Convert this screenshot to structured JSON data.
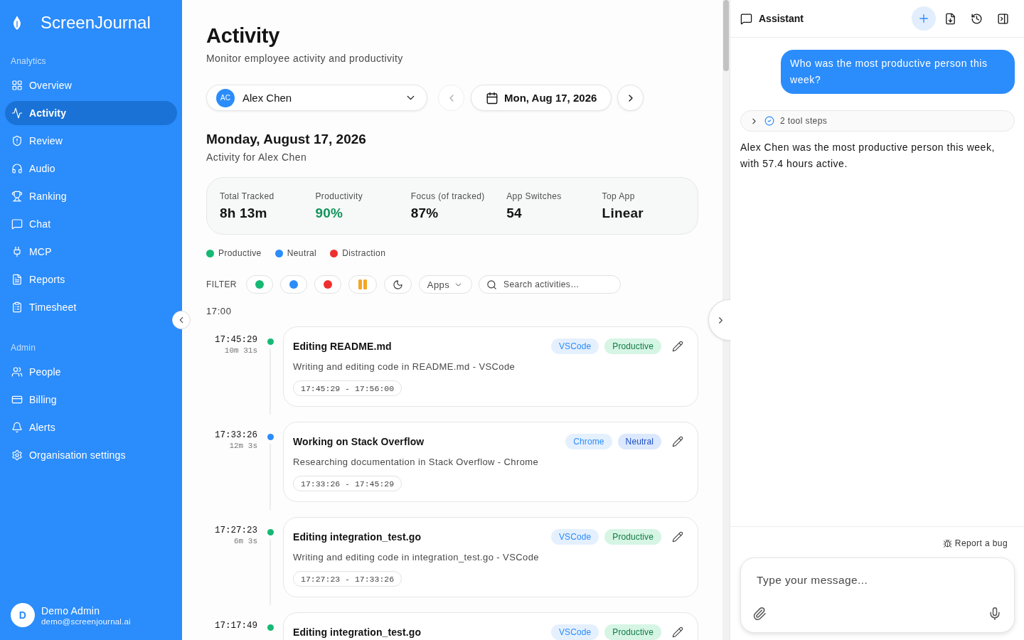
{
  "sidebar": {
    "brand": "ScreenJournal",
    "sections": [
      {
        "label": "Analytics",
        "items": [
          {
            "label": "Overview",
            "selected": false
          },
          {
            "label": "Activity",
            "selected": true
          },
          {
            "label": "Review",
            "selected": false
          },
          {
            "label": "Audio",
            "selected": false
          },
          {
            "label": "Ranking",
            "selected": false
          },
          {
            "label": "Chat",
            "selected": false
          },
          {
            "label": "MCP",
            "selected": false
          },
          {
            "label": "Reports",
            "selected": false
          },
          {
            "label": "Timesheet",
            "selected": false
          }
        ]
      },
      {
        "label": "Admin",
        "items": [
          {
            "label": "People",
            "selected": false
          },
          {
            "label": "Billing",
            "selected": false
          },
          {
            "label": "Alerts",
            "selected": false
          },
          {
            "label": "Organisation settings",
            "selected": false
          }
        ]
      }
    ],
    "user": {
      "initial": "D",
      "name": "Demo Admin",
      "email": "demo@screenjournal.ai"
    }
  },
  "page": {
    "title": "Activity",
    "subtitle": "Monitor employee activity and productivity"
  },
  "controls": {
    "user_select": {
      "initials": "AC",
      "value": "Alex Chen"
    },
    "previous_day": {
      "disabled": true
    },
    "date_picker": {
      "value": "Mon, Aug 17, 2026"
    },
    "next_day": {
      "disabled": false
    }
  },
  "day": {
    "heading": "Monday, August 17, 2026",
    "subheading": "Activity for Alex Chen"
  },
  "stats": [
    {
      "label": "Total Tracked",
      "value": "8h 13m",
      "kind": "plain"
    },
    {
      "label": "Productivity",
      "value": "90%",
      "kind": "good"
    },
    {
      "label": "Focus (of tracked)",
      "value": "87%",
      "kind": "plain"
    },
    {
      "label": "App Switches",
      "value": "54",
      "kind": "plain"
    },
    {
      "label": "Top App",
      "value": "Linear",
      "kind": "plain"
    }
  ],
  "legend": [
    {
      "label": "Productive",
      "color": "#16b873"
    },
    {
      "label": "Neutral",
      "color": "#2b8cfb"
    },
    {
      "label": "Distraction",
      "color": "#ef2f2f"
    }
  ],
  "filter": {
    "label": "FILTER",
    "chips": [
      {
        "kind": "dot",
        "color": "#16b873"
      },
      {
        "kind": "dot",
        "color": "#2b8cfb"
      },
      {
        "kind": "dot",
        "color": "#ef2f2f"
      },
      {
        "kind": "idle"
      },
      {
        "kind": "night"
      }
    ],
    "apps_dropdown": {
      "label": "Apps"
    },
    "search": {
      "placeholder": "Search activities…"
    }
  },
  "timeline": {
    "hour": "17:00",
    "entries": [
      {
        "time": "17:45:29",
        "duration": "10m 31s",
        "kind": "productive",
        "title": "Editing README.md",
        "app": "VSCode",
        "category": "Productive",
        "description": "Writing and editing code in README.md - VSCode",
        "range": "17:45:29 - 17:56:00"
      },
      {
        "time": "17:33:26",
        "duration": "12m 3s",
        "kind": "neutral",
        "title": "Working on Stack Overflow",
        "app": "Chrome",
        "category": "Neutral",
        "description": "Researching documentation in Stack Overflow - Chrome",
        "range": "17:33:26 - 17:45:29"
      },
      {
        "time": "17:27:23",
        "duration": "6m 3s",
        "kind": "productive",
        "title": "Editing integration_test.go",
        "app": "VSCode",
        "category": "Productive",
        "description": "Writing and editing code in integration_test.go - VSCode",
        "range": "17:27:23 - 17:33:26"
      },
      {
        "time": "17:17:49",
        "kind": "productive",
        "title": "Editing integration_test.go",
        "app": "VSCode",
        "category": "Productive"
      }
    ]
  },
  "assistant": {
    "title": "Assistant",
    "messages": [
      {
        "kind": "user",
        "text": "Who was the most productive person this week?"
      },
      {
        "kind": "tool_steps",
        "text": "2 tool steps",
        "expanded": false
      },
      {
        "kind": "assistant",
        "text": "Alex Chen was the most productive person this week, with 57.4 hours active."
      }
    ],
    "report_bug": "Report a bug",
    "composer": {
      "placeholder": "Type your message..."
    }
  }
}
